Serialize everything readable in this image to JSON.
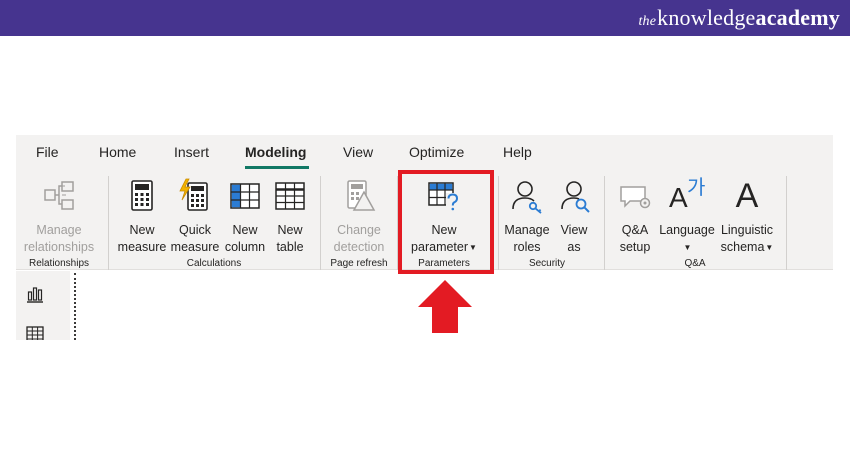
{
  "brand": {
    "the": "the",
    "knowledge": "knowledge",
    "academy": "academy"
  },
  "menu": {
    "file": "File",
    "home": "Home",
    "insert": "Insert",
    "modeling": "Modeling",
    "view": "View",
    "optimize": "Optimize",
    "help": "Help"
  },
  "buttons": {
    "manage_relationships": "Manage\nrelationships",
    "new_measure": "New\nmeasure",
    "quick_measure": "Quick\nmeasure",
    "new_column": "New\ncolumn",
    "new_table": "New\ntable",
    "change_detection": "Change\ndetection",
    "new_parameter_1": "New",
    "new_parameter_2": "parameter",
    "manage_roles": "Manage\nroles",
    "view_as": "View\nas",
    "qa_setup": "Q&A\nsetup",
    "language": "Language",
    "linguistic_1": "Linguistic",
    "linguistic_2": "schema"
  },
  "groups": {
    "relationships": "Relationships",
    "calculations": "Calculations",
    "page_refresh": "Page refresh",
    "parameters": "Parameters",
    "security": "Security",
    "qa": "Q&A"
  },
  "icons": {
    "linguistic_glyph": "A",
    "language_glyph_a": "A",
    "language_glyph_ga": "가"
  },
  "colors": {
    "brand_bar": "#46348f",
    "active_tab_underline": "#117865",
    "highlight": "#e31b23",
    "ribbon_bg": "#f3f2f1",
    "icon_blue": "#2b7cd3"
  }
}
